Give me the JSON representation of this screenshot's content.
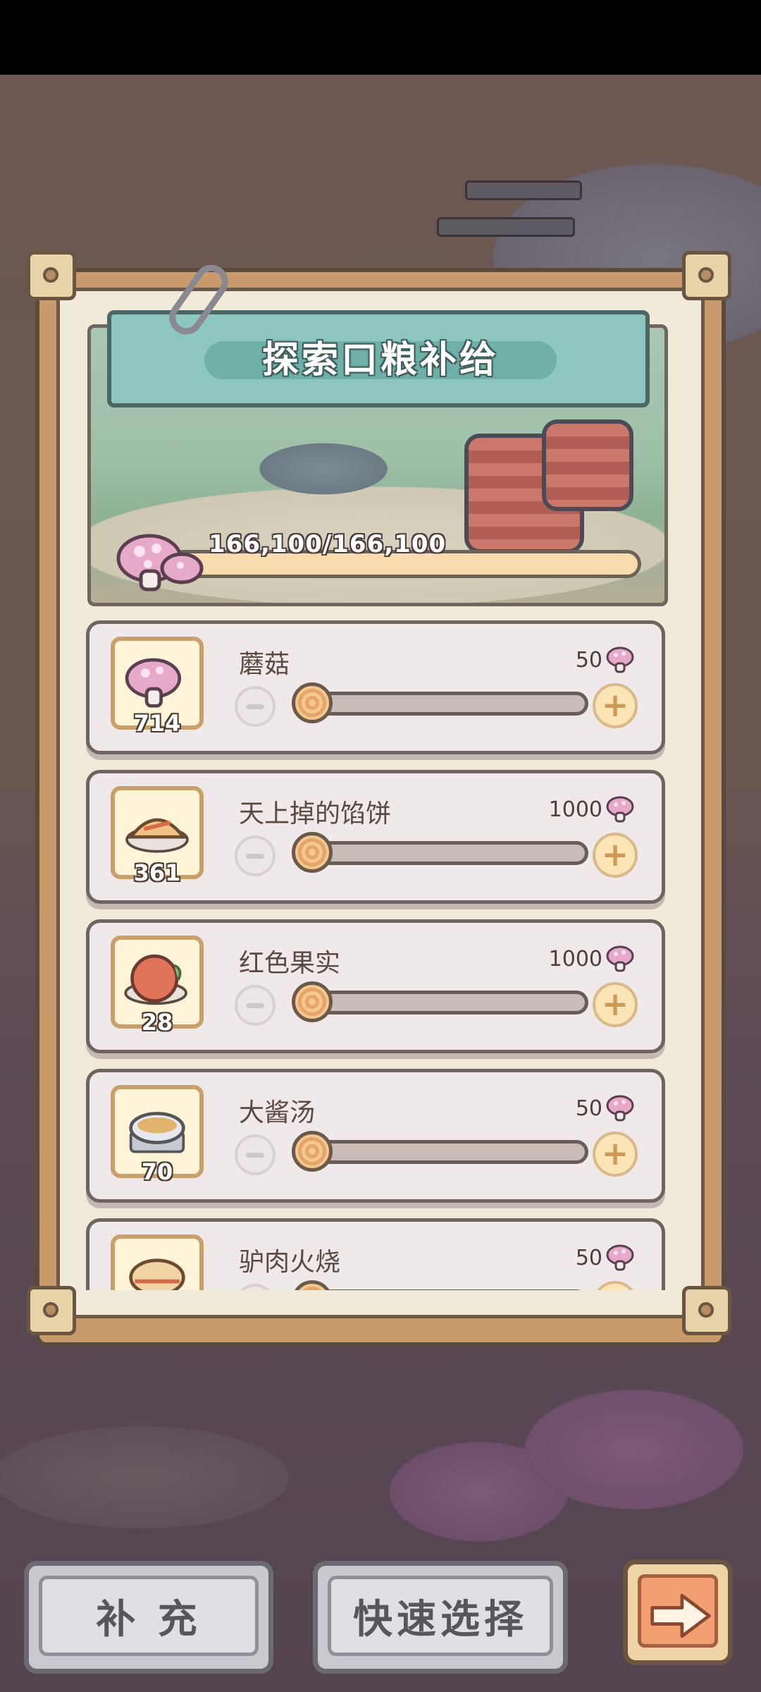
{
  "panel": {
    "title": "探索口粮补给",
    "progress_text": "166,100/166,100",
    "progress_fraction": 1.0
  },
  "items": [
    {
      "name": "蘑菇",
      "count": "714",
      "cost": "50",
      "icon": "mushroom-icon",
      "slider_fraction": 0.0
    },
    {
      "name": "天上掉的馅饼",
      "count": "361",
      "cost": "1000",
      "icon": "pie-icon",
      "slider_fraction": 0.0
    },
    {
      "name": "红色果实",
      "count": "28",
      "cost": "1000",
      "icon": "red-fruit-icon",
      "slider_fraction": 0.0
    },
    {
      "name": "大酱汤",
      "count": "70",
      "cost": "50",
      "icon": "soup-icon",
      "slider_fraction": 0.0
    },
    {
      "name": "驴肉火烧",
      "count": "",
      "cost": "50",
      "icon": "donkey-burger-icon",
      "slider_fraction": 0.0
    }
  ],
  "buttons": {
    "refill": "补 充",
    "quick_select": "快速选择",
    "next_icon": "arrow-right-icon"
  },
  "colors": {
    "banner": "#8ec6c0",
    "frame": "#c99b6c",
    "panel_bg": "#f2ead8",
    "accent_orange": "#f2a071"
  }
}
